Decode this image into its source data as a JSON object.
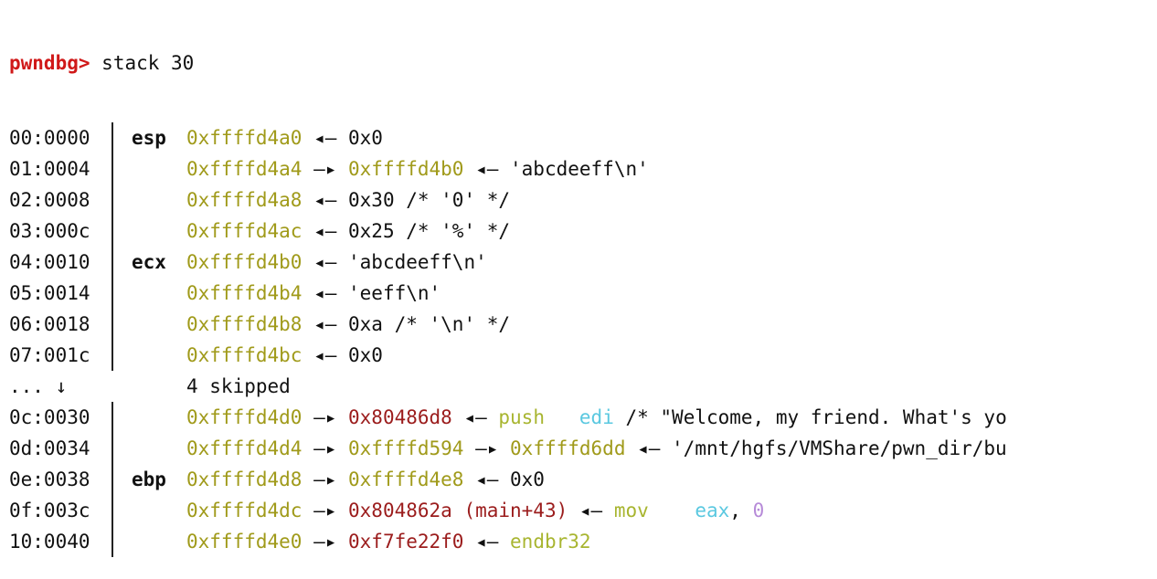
{
  "prompt": {
    "label": "pwndbg>",
    "command": "stack 30"
  },
  "rows": [
    {
      "off": "00:0000",
      "reg": "esp",
      "parts": [
        {
          "t": "0xffffd4a0",
          "c": "addr"
        },
        {
          "t": " ◂— 0x0",
          "c": "plain"
        }
      ]
    },
    {
      "off": "01:0004",
      "reg": "",
      "parts": [
        {
          "t": "0xffffd4a4",
          "c": "addr"
        },
        {
          "t": " —▸ ",
          "c": "plain"
        },
        {
          "t": "0xffffd4b0",
          "c": "addr"
        },
        {
          "t": " ◂— 'abcdeeff\\n'",
          "c": "plain"
        }
      ]
    },
    {
      "off": "02:0008",
      "reg": "",
      "parts": [
        {
          "t": "0xffffd4a8",
          "c": "addr"
        },
        {
          "t": " ◂— 0x30 /* '0' */",
          "c": "plain"
        }
      ]
    },
    {
      "off": "03:000c",
      "reg": "",
      "parts": [
        {
          "t": "0xffffd4ac",
          "c": "addr"
        },
        {
          "t": " ◂— 0x25 /* '%' */",
          "c": "plain"
        }
      ]
    },
    {
      "off": "04:0010",
      "reg": "ecx",
      "parts": [
        {
          "t": "0xffffd4b0",
          "c": "addr"
        },
        {
          "t": " ◂— 'abcdeeff\\n'",
          "c": "plain"
        }
      ]
    },
    {
      "off": "05:0014",
      "reg": "",
      "parts": [
        {
          "t": "0xffffd4b4",
          "c": "addr"
        },
        {
          "t": " ◂— 'eeff\\n'",
          "c": "plain"
        }
      ]
    },
    {
      "off": "06:0018",
      "reg": "",
      "parts": [
        {
          "t": "0xffffd4b8",
          "c": "addr"
        },
        {
          "t": " ◂— 0xa /* '\\n' */",
          "c": "plain"
        }
      ]
    },
    {
      "off": "07:001c",
      "reg": "",
      "parts": [
        {
          "t": "0xffffd4bc",
          "c": "addr"
        },
        {
          "t": " ◂— 0x0",
          "c": "plain"
        }
      ]
    },
    {
      "off": "... ↓",
      "reg": "",
      "skip": true,
      "parts": [
        {
          "t": "4 skipped",
          "c": "plain"
        }
      ]
    },
    {
      "off": "0c:0030",
      "reg": "",
      "parts": [
        {
          "t": "0xffffd4d0",
          "c": "addr"
        },
        {
          "t": " —▸ ",
          "c": "plain"
        },
        {
          "t": "0x80486d8",
          "c": "code"
        },
        {
          "t": " ◂— ",
          "c": "plain"
        },
        {
          "t": "push",
          "c": "asm"
        },
        {
          "t": "   ",
          "c": "plain"
        },
        {
          "t": "edi",
          "c": "ops"
        },
        {
          "t": " /* \"Welcome, my friend. What's yo",
          "c": "plain"
        }
      ]
    },
    {
      "off": "0d:0034",
      "reg": "",
      "parts": [
        {
          "t": "0xffffd4d4",
          "c": "addr"
        },
        {
          "t": " —▸ ",
          "c": "plain"
        },
        {
          "t": "0xffffd594",
          "c": "addr"
        },
        {
          "t": " —▸ ",
          "c": "plain"
        },
        {
          "t": "0xffffd6dd",
          "c": "addr"
        },
        {
          "t": " ◂— '/mnt/hgfs/VMShare/pwn_dir/bu",
          "c": "plain"
        }
      ]
    },
    {
      "off": "0e:0038",
      "reg": "ebp",
      "parts": [
        {
          "t": "0xffffd4d8",
          "c": "addr"
        },
        {
          "t": " —▸ ",
          "c": "plain"
        },
        {
          "t": "0xffffd4e8",
          "c": "addr"
        },
        {
          "t": " ◂— 0x0",
          "c": "plain"
        }
      ]
    },
    {
      "off": "0f:003c",
      "reg": "",
      "parts": [
        {
          "t": "0xffffd4dc",
          "c": "addr"
        },
        {
          "t": " —▸ ",
          "c": "plain"
        },
        {
          "t": "0x804862a (main+43)",
          "c": "code"
        },
        {
          "t": " ◂— ",
          "c": "plain"
        },
        {
          "t": "mov",
          "c": "asm"
        },
        {
          "t": "    ",
          "c": "plain"
        },
        {
          "t": "eax",
          "c": "ops"
        },
        {
          "t": ", ",
          "c": "plain"
        },
        {
          "t": "0",
          "c": "num"
        }
      ]
    },
    {
      "off": "10:0040",
      "reg": "",
      "parts": [
        {
          "t": "0xffffd4e0",
          "c": "addr"
        },
        {
          "t": " —▸ ",
          "c": "plain"
        },
        {
          "t": "0xf7fe22f0",
          "c": "code"
        },
        {
          "t": " ◂— ",
          "c": "plain"
        },
        {
          "t": "endbr32",
          "c": "asm"
        }
      ]
    }
  ]
}
